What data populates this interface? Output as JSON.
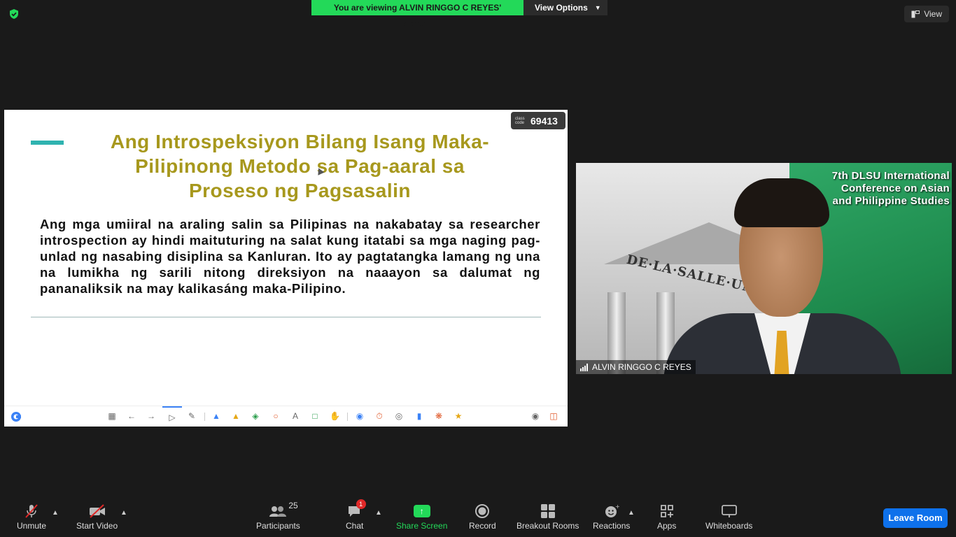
{
  "top_bar": {
    "banner_text": "You are viewing ALVIN RINGGO C REYES' screen",
    "view_options_label": "View Options",
    "view_label": "View"
  },
  "slide": {
    "title_lines": [
      "Ang Introspeksiyon Bilang Isang Maka-",
      "Pilipinong Metodo sa Pag-aaral sa",
      "Proseso ng Pagsasalin"
    ],
    "body": "Ang mga umiiral na araling salin sa Pilipinas na nakabatay sa researcher introspection ay hindi maituturing na salat kung itatabi sa mga naging pag-unlad ng nasabing disiplina sa Kanluran. Ito ay pagtatangka lamang ng una na lumikha ng sarili nitong direksiyon na naaayon sa dalumat ng pananaliksik na may kalikasáng maka-Pilipino.",
    "class_code_label": "class code",
    "class_code": "69413",
    "accent_color": "#2fb3b0",
    "title_color": "#a7981d"
  },
  "video": {
    "participant_name": "ALVIN RINGGO C REYES",
    "background_text_lines": [
      "7th DLSU International",
      "Conference on Asian",
      "and Philippine Studies"
    ],
    "building_sign": "DE·LA·SALLE·UNIVERS"
  },
  "toolbar": {
    "unmute_label": "Unmute",
    "start_video_label": "Start Video",
    "participants_label": "Participants",
    "participants_count": "25",
    "chat_label": "Chat",
    "chat_badge": "1",
    "share_screen_label": "Share Screen",
    "record_label": "Record",
    "breakout_rooms_label": "Breakout Rooms",
    "reactions_label": "Reactions",
    "apps_label": "Apps",
    "whiteboards_label": "Whiteboards",
    "leave_label": "Leave Room",
    "share_color": "#23d959",
    "leave_color": "#0e71eb"
  }
}
